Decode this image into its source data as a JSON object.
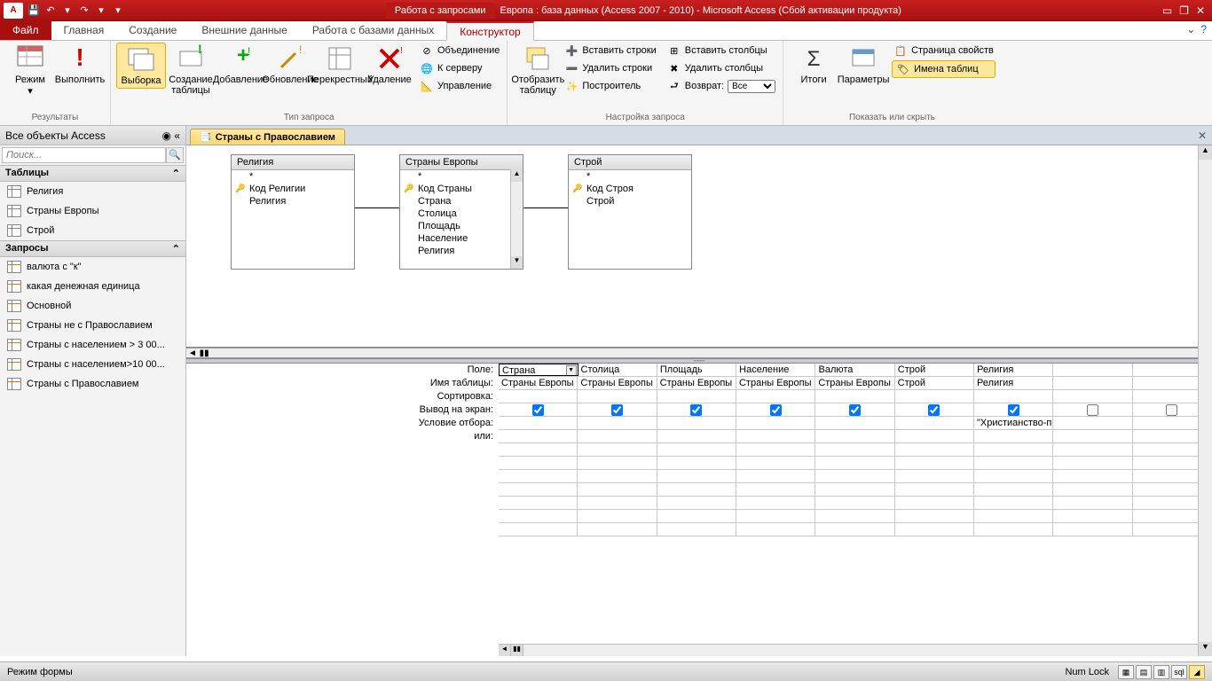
{
  "title": {
    "context_label": "Работа с запросами",
    "text": "Европа : база данных (Access 2007 - 2010)  -  Microsoft Access (Сбой активации продукта)"
  },
  "tabs": {
    "file": "Файл",
    "home": "Главная",
    "create": "Создание",
    "external": "Внешние данные",
    "dbtools": "Работа с базами данных",
    "design": "Конструктор"
  },
  "ribbon": {
    "results": {
      "view": "Режим",
      "run": "Выполнить",
      "group": "Результаты"
    },
    "qtype": {
      "select": "Выборка",
      "make": "Создание\nтаблицы",
      "append": "Добавление",
      "update": "Обновление",
      "crosstab": "Перекрестный",
      "delete": "Удаление",
      "union": "Объединение",
      "passthrough": "К серверу",
      "datadef": "Управление",
      "group": "Тип запроса"
    },
    "setup": {
      "show": "Отобразить\nтаблицу",
      "insrow": "Вставить строки",
      "delrow": "Удалить строки",
      "builder": "Построитель",
      "inscol": "Вставить столбцы",
      "delcol": "Удалить столбцы",
      "return": "Возврат:",
      "return_val": "Все",
      "group": "Настройка запроса"
    },
    "showhide": {
      "totals": "Итоги",
      "params": "Параметры",
      "propsheet": "Страница свойств",
      "tablenames": "Имена таблиц",
      "group": "Показать или скрыть"
    }
  },
  "nav": {
    "header": "Все объекты Access",
    "search_placeholder": "Поиск...",
    "tables_label": "Таблицы",
    "tables": [
      "Религия",
      "Страны Европы",
      "Строй"
    ],
    "queries_label": "Запросы",
    "queries": [
      "валюта с \"к\"",
      "какая денежная единица",
      "Основной",
      "Страны не с Православием",
      "Страны с населением > 3 00...",
      "Страны с населением>10 00...",
      "Страны с Православием"
    ]
  },
  "doc_tab": "Страны с Православием",
  "tableboxes": {
    "t1": {
      "title": "Религия",
      "fields": [
        "*",
        "Код Религии",
        "Религия"
      ],
      "key_idx": 1
    },
    "t2": {
      "title": "Страны Европы",
      "fields": [
        "*",
        "Код Страны",
        "Страна",
        "Столица",
        "Площадь",
        "Население",
        "Религия"
      ],
      "key_idx": 1
    },
    "t3": {
      "title": "Строй",
      "fields": [
        "*",
        "Код Строя",
        "Строй"
      ],
      "key_idx": 1
    }
  },
  "grid": {
    "labels": {
      "field": "Поле:",
      "table": "Имя таблицы:",
      "sort": "Сортировка:",
      "show": "Вывод на экран:",
      "criteria": "Условие отбора:",
      "or": "или:"
    },
    "cols": [
      {
        "field": "Страна",
        "table": "Страны Европы",
        "show": true,
        "criteria": ""
      },
      {
        "field": "Столица",
        "table": "Страны Европы",
        "show": true,
        "criteria": ""
      },
      {
        "field": "Площадь",
        "table": "Страны Европы",
        "show": true,
        "criteria": ""
      },
      {
        "field": "Население",
        "table": "Страны Европы",
        "show": true,
        "criteria": ""
      },
      {
        "field": "Валюта",
        "table": "Страны Европы",
        "show": true,
        "criteria": ""
      },
      {
        "field": "Строй",
        "table": "Строй",
        "show": true,
        "criteria": ""
      },
      {
        "field": "Религия",
        "table": "Религия",
        "show": true,
        "criteria": "\"Христианство-право"
      },
      {
        "field": "",
        "table": "",
        "show": false,
        "criteria": ""
      },
      {
        "field": "",
        "table": "",
        "show": false,
        "criteria": ""
      }
    ]
  },
  "status": {
    "left": "Режим формы",
    "numlock": "Num Lock"
  }
}
